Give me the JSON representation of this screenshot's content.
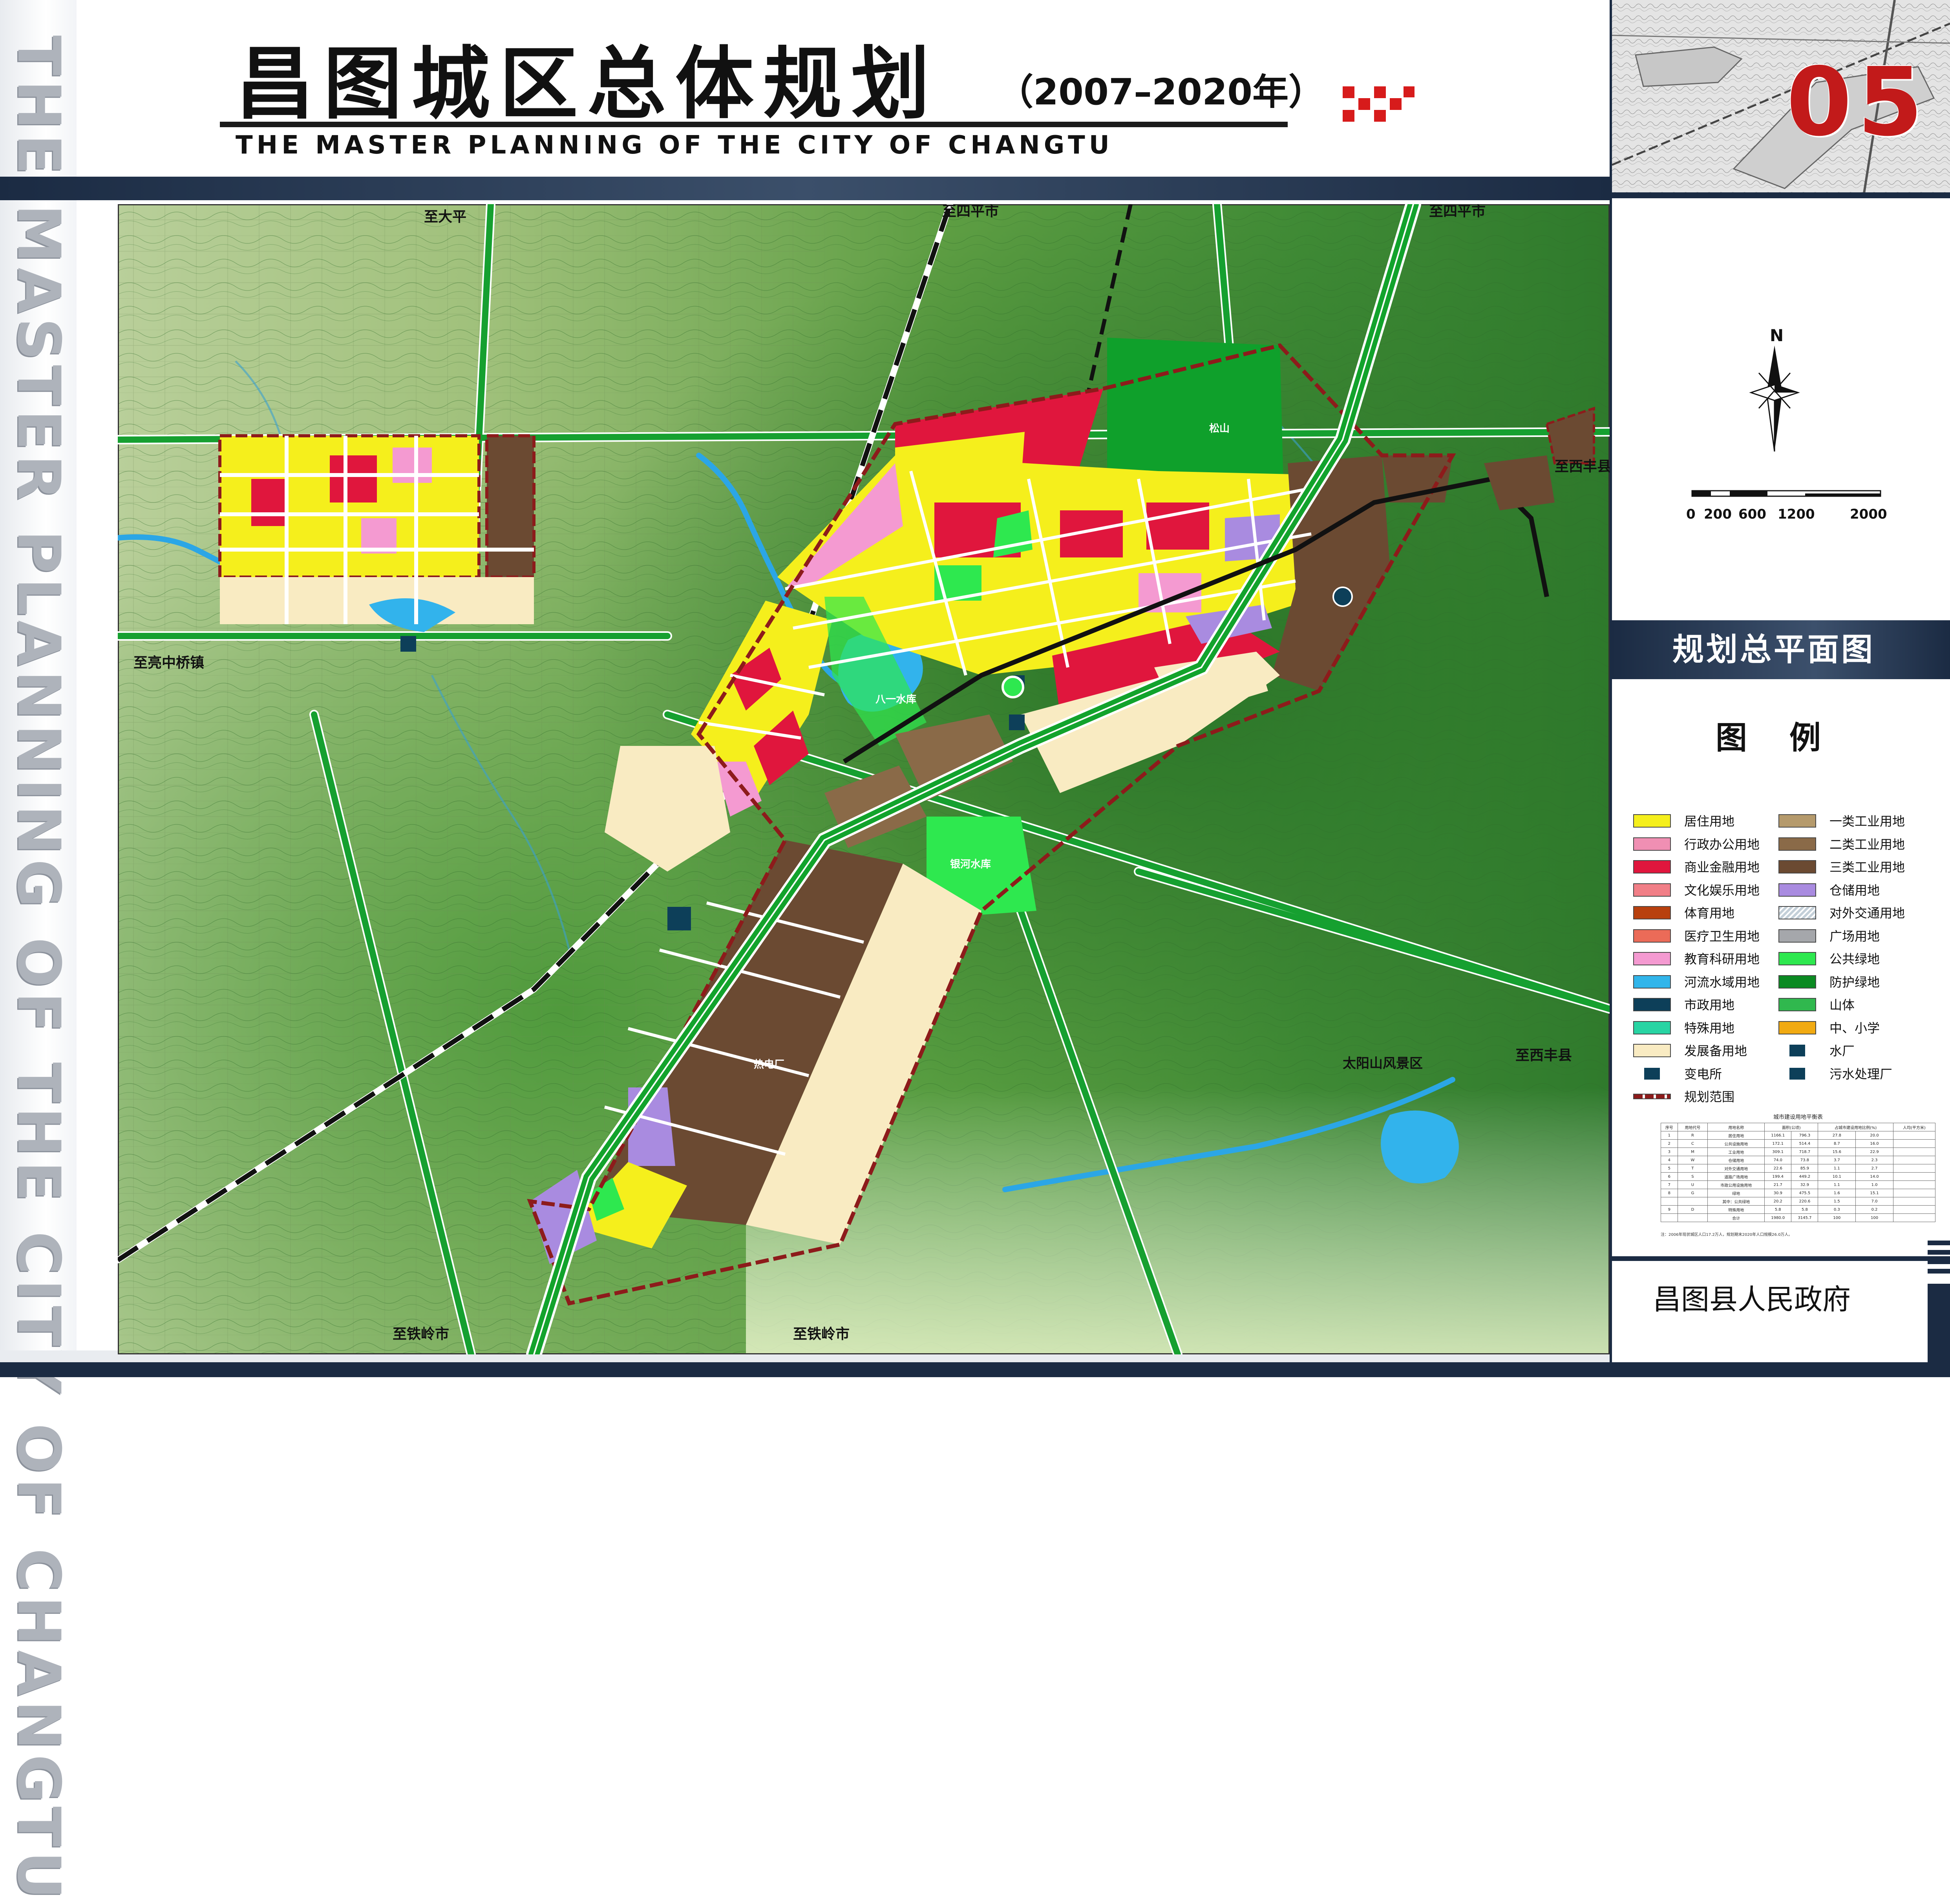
{
  "header": {
    "title_cn": "昌图城区总体规划",
    "years": "（2007–2020年）",
    "title_en": "THE MASTER PLANNING OF THE CITY OF CHANGTU",
    "vertical_title": "THE MASTER PLANNING OF THE CITY OF CHANGTU",
    "page_number": "05"
  },
  "panel": {
    "title": "规划总平面图",
    "north": "N",
    "scale_labels": [
      "0",
      "200",
      "600",
      "1200",
      "2000"
    ],
    "legend_heading": "图 例",
    "issuer": "昌图县人民政府"
  },
  "legend": [
    {
      "label": "居住用地",
      "color": "#f5ef1c",
      "pattern": ""
    },
    {
      "label": "一类工业用地",
      "color": "#b59a6c",
      "pattern": ""
    },
    {
      "label": "行政办公用地",
      "color": "#f08fb3",
      "pattern": ""
    },
    {
      "label": "二类工业用地",
      "color": "#8a6a48",
      "pattern": ""
    },
    {
      "label": "商业金融用地",
      "color": "#e0163d",
      "pattern": ""
    },
    {
      "label": "三类工业用地",
      "color": "#6b4a32",
      "pattern": ""
    },
    {
      "label": "文化娱乐用地",
      "color": "#f17f87",
      "pattern": ""
    },
    {
      "label": "仓储用地",
      "color": "#a98be0",
      "pattern": ""
    },
    {
      "label": "体育用地",
      "color": "#b8400e",
      "pattern": ""
    },
    {
      "label": "对外交通用地",
      "color": "#c3cfd8",
      "pattern": "hatch"
    },
    {
      "label": "医疗卫生用地",
      "color": "#eb6b58",
      "pattern": ""
    },
    {
      "label": "广场用地",
      "color": "#a5a7ab",
      "pattern": ""
    },
    {
      "label": "教育科研用地",
      "color": "#f49ad1",
      "pattern": ""
    },
    {
      "label": "公共绿地",
      "color": "#2ee84f",
      "pattern": ""
    },
    {
      "label": "河流水域用地",
      "color": "#31b5ea",
      "pattern": ""
    },
    {
      "label": "防护绿地",
      "color": "#0b8a22",
      "pattern": ""
    },
    {
      "label": "市政用地",
      "color": "#0d3f59",
      "pattern": ""
    },
    {
      "label": "山体",
      "color": "#30b84e",
      "pattern": ""
    },
    {
      "label": "特殊用地",
      "color": "#28d4a3",
      "pattern": ""
    },
    {
      "label": "中、小学",
      "color": "#f1aa12",
      "pattern": ""
    },
    {
      "label": "发展备用地",
      "color": "#f9ebc2",
      "pattern": ""
    },
    {
      "label": "水厂",
      "color": "#0d3f59",
      "pattern": "icon"
    },
    {
      "label": "变电所",
      "color": "#0d3f59",
      "pattern": "icon"
    },
    {
      "label": "污水处理厂",
      "color": "#0d3f59",
      "pattern": "icon"
    },
    {
      "label": "规划范围",
      "color": "#8d1b1b",
      "pattern": "boundary"
    }
  ],
  "map": {
    "labels": [
      {
        "text": "至大平"
      },
      {
        "text": "至四平市"
      },
      {
        "text": "至四平市"
      },
      {
        "text": "至西丰县"
      },
      {
        "text": "至西丰县"
      },
      {
        "text": "至亮中桥镇"
      },
      {
        "text": "至铁岭市"
      },
      {
        "text": "至铁岭市"
      },
      {
        "text": "太阳山风景区"
      },
      {
        "text": "八一水库"
      },
      {
        "text": "银河水库"
      },
      {
        "text": "热电厂"
      },
      {
        "text": "松山"
      }
    ]
  },
  "stats": {
    "title": "城市建设用地平衡表",
    "header": [
      "序号",
      "用地代号",
      "用地名称",
      "面积(公顷)",
      "占城市建设用地比例(%)",
      "人均(平方米)"
    ],
    "rows": [
      [
        "1",
        "R",
        "居住用地",
        "1166.1",
        "796.3",
        "27.8",
        "20.0"
      ],
      [
        "2",
        "C",
        "公共设施用地",
        "172.1",
        "514.4",
        "8.7",
        "16.0"
      ],
      [
        "3",
        "M",
        "工业用地",
        "309.1",
        "718.7",
        "15.6",
        "22.9"
      ],
      [
        "4",
        "W",
        "仓储用地",
        "74.0",
        "73.8",
        "3.7",
        "2.3"
      ],
      [
        "5",
        "T",
        "对外交通用地",
        "22.6",
        "85.9",
        "1.1",
        "2.7"
      ],
      [
        "6",
        "S",
        "道路广场用地",
        "199.4",
        "449.2",
        "10.1",
        "14.0"
      ],
      [
        "7",
        "U",
        "市政公用设施用地",
        "21.7",
        "32.9",
        "1.1",
        "1.0"
      ],
      [
        "8",
        "G",
        "绿地",
        "30.9",
        "475.5",
        "1.6",
        "15.1"
      ],
      [
        "",
        "",
        "其中：公共绿地",
        "20.2",
        "220.6",
        "1.5",
        "7.0"
      ],
      [
        "9",
        "D",
        "特殊用地",
        "5.8",
        "5.8",
        "0.3",
        "0.2"
      ],
      [
        "",
        "",
        "合计",
        "1980.0",
        "3145.7",
        "100",
        "100"
      ]
    ],
    "note": "注：2006年现状城区人口17.2万人，规划期末2020年人口规模26.0万人。"
  }
}
